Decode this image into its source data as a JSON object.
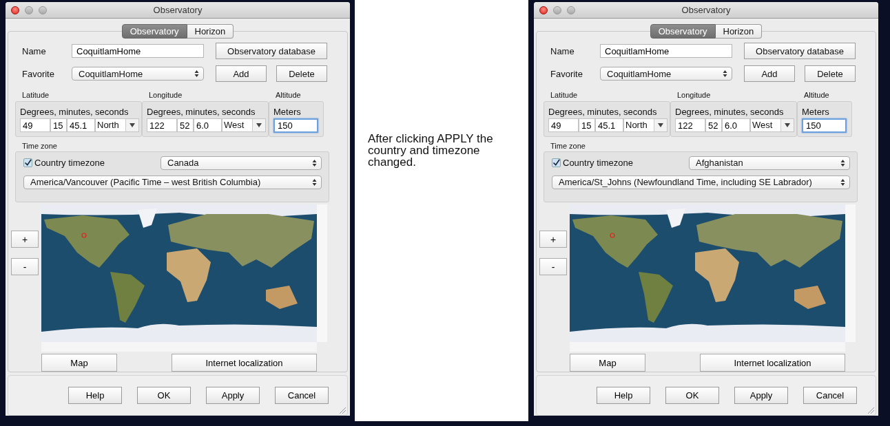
{
  "dialogs": [
    {
      "title": "Observatory",
      "tabs": [
        {
          "label": "Observatory",
          "selected": true
        },
        {
          "label": "Horizon",
          "selected": false
        }
      ],
      "name": {
        "label": "Name",
        "value": "CoquitlamHome"
      },
      "database_button": "Observatory database",
      "favorite": {
        "label": "Favorite",
        "value": "CoquitlamHome"
      },
      "add_button": "Add",
      "delete_button": "Delete",
      "latitude": {
        "label": "Latitude",
        "caption": "Degrees, minutes, seconds",
        "degrees": "49",
        "minutes": "15",
        "seconds": "45.1",
        "hemisphere": "North"
      },
      "longitude": {
        "label": "Longitude",
        "caption": "Degrees, minutes, seconds",
        "degrees": "122",
        "minutes": "52",
        "seconds": "6.0",
        "hemisphere": "West"
      },
      "altitude": {
        "label": "Altitude",
        "caption": "Meters",
        "value": "150",
        "focused": true
      },
      "time_zone": {
        "label": "Time zone",
        "country_timezone": {
          "label": "Country timezone",
          "checked": true
        },
        "country": "Canada",
        "zone": "America/Vancouver (Pacific Time – west British Columbia)"
      },
      "zoom_buttons": [
        "+",
        "-"
      ],
      "map_buttons": [
        "Map",
        "Internet localization"
      ],
      "buttons": [
        "Help",
        "OK",
        "Apply",
        "Cancel"
      ]
    },
    {
      "title": "Observatory",
      "tabs": [
        {
          "label": "Observatory",
          "selected": true
        },
        {
          "label": "Horizon",
          "selected": false
        }
      ],
      "name": {
        "label": "Name",
        "value": "CoquitlamHome"
      },
      "database_button": "Observatory database",
      "favorite": {
        "label": "Favorite",
        "value": "CoquitlamHome"
      },
      "add_button": "Add",
      "delete_button": "Delete",
      "latitude": {
        "label": "Latitude",
        "caption": "Degrees, minutes, seconds",
        "degrees": "49",
        "minutes": "15",
        "seconds": "45.1",
        "hemisphere": "North"
      },
      "longitude": {
        "label": "Longitude",
        "caption": "Degrees, minutes, seconds",
        "degrees": "122",
        "minutes": "52",
        "seconds": "6.0",
        "hemisphere": "West"
      },
      "altitude": {
        "label": "Altitude",
        "caption": "Meters",
        "value": "150",
        "focused": true
      },
      "time_zone": {
        "label": "Time zone",
        "country_timezone": {
          "label": "Country timezone",
          "checked": true
        },
        "country": "Afghanistan",
        "zone": "America/St_Johns (Newfoundland Time, including SE Labrador)"
      },
      "zoom_buttons": [
        "+",
        "-"
      ],
      "map_buttons": [
        "Map",
        "Internet localization"
      ],
      "buttons": [
        "Help",
        "OK",
        "Apply",
        "Cancel"
      ]
    }
  ],
  "note": "After clicking APPLY the country and timezone changed."
}
